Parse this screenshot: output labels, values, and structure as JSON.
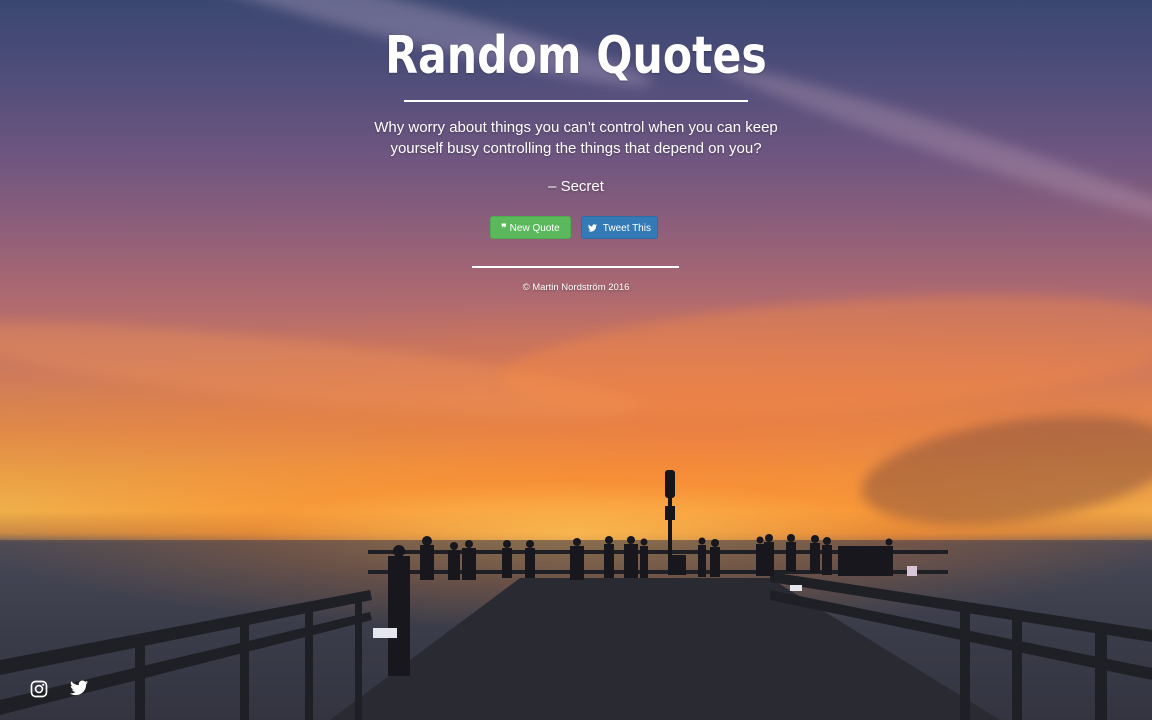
{
  "page": {
    "title": "Random Quotes"
  },
  "quote": {
    "text": "Why worry about things you can’t control when you can keep yourself busy controlling the things that depend on you?",
    "author": "– Secret"
  },
  "buttons": {
    "new_quote": {
      "icon": "quote-icon",
      "icon_glyph": "❞",
      "label": "New Quote",
      "color": "#5cb85c"
    },
    "tweet": {
      "icon": "twitter-icon",
      "icon_glyph": "✔",
      "label": "Tweet This",
      "color": "#337ab7"
    }
  },
  "footer": {
    "copyright": "© Martin Nordström 2016"
  },
  "social": {
    "instagram_icon": "instagram-icon",
    "twitter_icon": "twitter-icon"
  }
}
